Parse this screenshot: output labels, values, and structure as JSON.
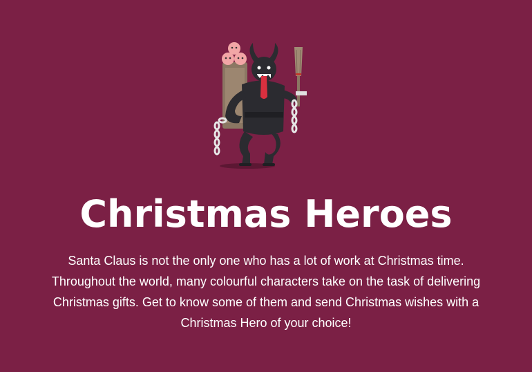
{
  "hero": {
    "illustration_icon": "krampus-illustration",
    "title": "Christmas Heroes",
    "intro": "Santa Claus is not the only one who has a lot of work at Christmas time. Throughout the world, many colourful characters take on the task of delivering Christmas gifts. Get to know some of them and send Christmas wishes with a Christmas Hero of your choice!"
  },
  "colors": {
    "background": "#7b2045",
    "text": "#ffffff"
  }
}
